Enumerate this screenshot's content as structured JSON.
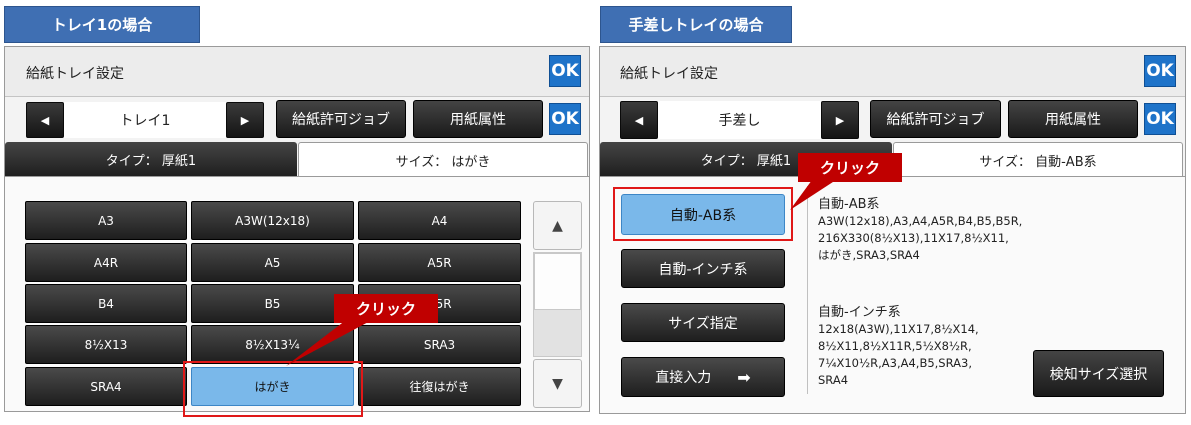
{
  "left": {
    "case_label": "トレイ1の場合",
    "title": "給紙トレイ設定",
    "ok_top": "OK",
    "ok_nav": "OK",
    "prev_arrow": "◀",
    "next_arrow": "▶",
    "tray_label": "トレイ1",
    "job_button": "給紙許可ジョブ",
    "attr_button": "用紙属性",
    "tab_type": "タイプ：  厚紙1",
    "tab_size": "サイズ：  はがき",
    "sizes": [
      "A3",
      "A3W(12x18)",
      "A4",
      "A4R",
      "A5",
      "A5R",
      "B4",
      "B5",
      "B5R",
      "8½X13",
      "8½X13¼",
      "SRA3",
      "SRA4",
      "はがき",
      "往復はがき"
    ],
    "selected_size": "はがき",
    "scroll_up": "▲",
    "scroll_down": "▼",
    "callout": "クリック"
  },
  "right": {
    "case_label": "手差しトレイの場合",
    "title": "給紙トレイ設定",
    "ok_top": "OK",
    "ok_nav": "OK",
    "prev_arrow": "◀",
    "next_arrow": "▶",
    "tray_label": "手差し",
    "job_button": "給紙許可ジョブ",
    "attr_button": "用紙属性",
    "tab_type": "タイプ：  厚紙1",
    "tab_size": "サイズ：  自動-AB系",
    "modes": [
      {
        "label": "自動-AB系",
        "selected": true
      },
      {
        "label": "自動-インチ系",
        "selected": false
      },
      {
        "label": "サイズ指定",
        "selected": false
      },
      {
        "label": "直接入力",
        "selected": false
      }
    ],
    "direct_arrow": "➡",
    "ab_head": "自動-AB系",
    "ab_body": "A3W(12x18),A3,A4,A5R,B4,B5,B5R,\n216X330(8½X13),11X17,8½X11,\nはがき,SRA3,SRA4",
    "inch_head": "自動-インチ系",
    "inch_body": "12x18(A3W),11X17,8½X14,\n8½X11,8½X11R,5½X8½R,\n7¼X10½R,A3,A4,B5,SRA3,\nSRA4",
    "detect_button": "検知サイズ選択",
    "callout": "クリック"
  },
  "colors": {
    "ok_blue": "#1e73c9",
    "callout_red": "#c00000",
    "selected_blue": "#7ab8ea",
    "tag_blue": "#3f6fb3"
  }
}
